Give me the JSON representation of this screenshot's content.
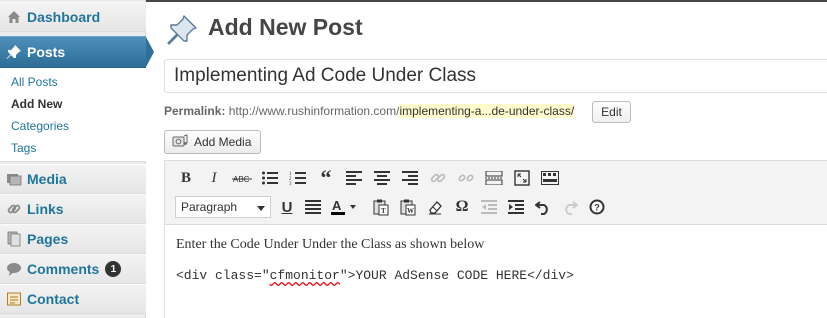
{
  "sidebar": {
    "dashboard": "Dashboard",
    "posts": "Posts",
    "submenu": [
      "All Posts",
      "Add New",
      "Categories",
      "Tags"
    ],
    "media": "Media",
    "links": "Links",
    "pages": "Pages",
    "comments": "Comments",
    "comments_count": "1",
    "contact": "Contact"
  },
  "page": {
    "title": "Add New Post"
  },
  "post": {
    "title_value": "Implementing Ad Code Under Class",
    "permalink_label": "Permalink:",
    "permalink_base": "http://www.rushinformation.com/",
    "permalink_slug": "implementing-a...de-under-class/",
    "edit_label": "Edit",
    "add_media_label": "Add Media"
  },
  "editor": {
    "format_select": "Paragraph",
    "toolbar_row1": [
      "bold-icon",
      "italic-icon",
      "strikethrough-icon",
      "bullet-list-icon",
      "numbered-list-icon",
      "blockquote-icon",
      "align-left-icon",
      "align-center-icon",
      "align-right-icon",
      "insert-link-icon",
      "unlink-icon",
      "insert-more-icon",
      "fullscreen-icon",
      "toolbar-toggle-icon"
    ],
    "toolbar_row2": [
      "underline-icon",
      "justify-icon",
      "text-color-icon",
      "paste-as-text-icon",
      "paste-from-word-icon",
      "clear-formatting-icon",
      "special-character-icon",
      "outdent-icon",
      "indent-icon",
      "undo-icon",
      "redo-icon",
      "help-icon"
    ],
    "paragraph_text": "Enter the Code Under Under the Class as shown below",
    "code_before": "<div class=\"",
    "code_misspelled": "cfmonitor",
    "code_after": "\">YOUR AdSense CODE HERE</div>"
  },
  "colors": {
    "link": "#21759b",
    "current_menu": "#2d6e98",
    "slug_highlight": "#fffbcc"
  }
}
